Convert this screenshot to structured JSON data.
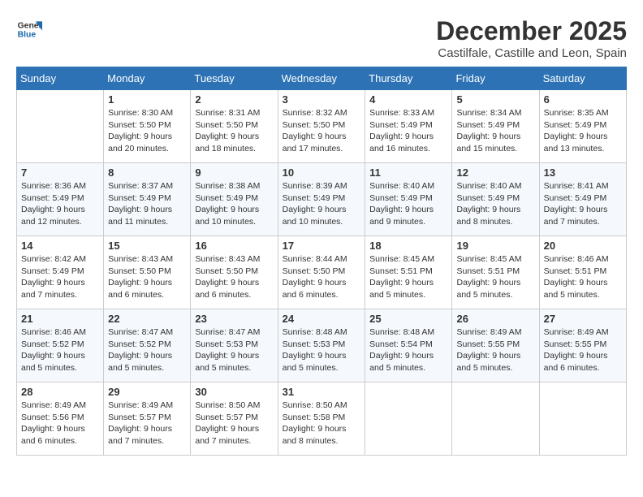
{
  "logo": {
    "line1": "General",
    "line2": "Blue"
  },
  "title": "December 2025",
  "subtitle": "Castilfale, Castille and Leon, Spain",
  "days_of_week": [
    "Sunday",
    "Monday",
    "Tuesday",
    "Wednesday",
    "Thursday",
    "Friday",
    "Saturday"
  ],
  "weeks": [
    [
      {
        "day": "",
        "info": ""
      },
      {
        "day": "1",
        "info": "Sunrise: 8:30 AM\nSunset: 5:50 PM\nDaylight: 9 hours\nand 20 minutes."
      },
      {
        "day": "2",
        "info": "Sunrise: 8:31 AM\nSunset: 5:50 PM\nDaylight: 9 hours\nand 18 minutes."
      },
      {
        "day": "3",
        "info": "Sunrise: 8:32 AM\nSunset: 5:50 PM\nDaylight: 9 hours\nand 17 minutes."
      },
      {
        "day": "4",
        "info": "Sunrise: 8:33 AM\nSunset: 5:49 PM\nDaylight: 9 hours\nand 16 minutes."
      },
      {
        "day": "5",
        "info": "Sunrise: 8:34 AM\nSunset: 5:49 PM\nDaylight: 9 hours\nand 15 minutes."
      },
      {
        "day": "6",
        "info": "Sunrise: 8:35 AM\nSunset: 5:49 PM\nDaylight: 9 hours\nand 13 minutes."
      }
    ],
    [
      {
        "day": "7",
        "info": "Sunrise: 8:36 AM\nSunset: 5:49 PM\nDaylight: 9 hours\nand 12 minutes."
      },
      {
        "day": "8",
        "info": "Sunrise: 8:37 AM\nSunset: 5:49 PM\nDaylight: 9 hours\nand 11 minutes."
      },
      {
        "day": "9",
        "info": "Sunrise: 8:38 AM\nSunset: 5:49 PM\nDaylight: 9 hours\nand 10 minutes."
      },
      {
        "day": "10",
        "info": "Sunrise: 8:39 AM\nSunset: 5:49 PM\nDaylight: 9 hours\nand 10 minutes."
      },
      {
        "day": "11",
        "info": "Sunrise: 8:40 AM\nSunset: 5:49 PM\nDaylight: 9 hours\nand 9 minutes."
      },
      {
        "day": "12",
        "info": "Sunrise: 8:40 AM\nSunset: 5:49 PM\nDaylight: 9 hours\nand 8 minutes."
      },
      {
        "day": "13",
        "info": "Sunrise: 8:41 AM\nSunset: 5:49 PM\nDaylight: 9 hours\nand 7 minutes."
      }
    ],
    [
      {
        "day": "14",
        "info": "Sunrise: 8:42 AM\nSunset: 5:49 PM\nDaylight: 9 hours\nand 7 minutes."
      },
      {
        "day": "15",
        "info": "Sunrise: 8:43 AM\nSunset: 5:50 PM\nDaylight: 9 hours\nand 6 minutes."
      },
      {
        "day": "16",
        "info": "Sunrise: 8:43 AM\nSunset: 5:50 PM\nDaylight: 9 hours\nand 6 minutes."
      },
      {
        "day": "17",
        "info": "Sunrise: 8:44 AM\nSunset: 5:50 PM\nDaylight: 9 hours\nand 6 minutes."
      },
      {
        "day": "18",
        "info": "Sunrise: 8:45 AM\nSunset: 5:51 PM\nDaylight: 9 hours\nand 5 minutes."
      },
      {
        "day": "19",
        "info": "Sunrise: 8:45 AM\nSunset: 5:51 PM\nDaylight: 9 hours\nand 5 minutes."
      },
      {
        "day": "20",
        "info": "Sunrise: 8:46 AM\nSunset: 5:51 PM\nDaylight: 9 hours\nand 5 minutes."
      }
    ],
    [
      {
        "day": "21",
        "info": "Sunrise: 8:46 AM\nSunset: 5:52 PM\nDaylight: 9 hours\nand 5 minutes."
      },
      {
        "day": "22",
        "info": "Sunrise: 8:47 AM\nSunset: 5:52 PM\nDaylight: 9 hours\nand 5 minutes."
      },
      {
        "day": "23",
        "info": "Sunrise: 8:47 AM\nSunset: 5:53 PM\nDaylight: 9 hours\nand 5 minutes."
      },
      {
        "day": "24",
        "info": "Sunrise: 8:48 AM\nSunset: 5:53 PM\nDaylight: 9 hours\nand 5 minutes."
      },
      {
        "day": "25",
        "info": "Sunrise: 8:48 AM\nSunset: 5:54 PM\nDaylight: 9 hours\nand 5 minutes."
      },
      {
        "day": "26",
        "info": "Sunrise: 8:49 AM\nSunset: 5:55 PM\nDaylight: 9 hours\nand 5 minutes."
      },
      {
        "day": "27",
        "info": "Sunrise: 8:49 AM\nSunset: 5:55 PM\nDaylight: 9 hours\nand 6 minutes."
      }
    ],
    [
      {
        "day": "28",
        "info": "Sunrise: 8:49 AM\nSunset: 5:56 PM\nDaylight: 9 hours\nand 6 minutes."
      },
      {
        "day": "29",
        "info": "Sunrise: 8:49 AM\nSunset: 5:57 PM\nDaylight: 9 hours\nand 7 minutes."
      },
      {
        "day": "30",
        "info": "Sunrise: 8:50 AM\nSunset: 5:57 PM\nDaylight: 9 hours\nand 7 minutes."
      },
      {
        "day": "31",
        "info": "Sunrise: 8:50 AM\nSunset: 5:58 PM\nDaylight: 9 hours\nand 8 minutes."
      },
      {
        "day": "",
        "info": ""
      },
      {
        "day": "",
        "info": ""
      },
      {
        "day": "",
        "info": ""
      }
    ]
  ]
}
